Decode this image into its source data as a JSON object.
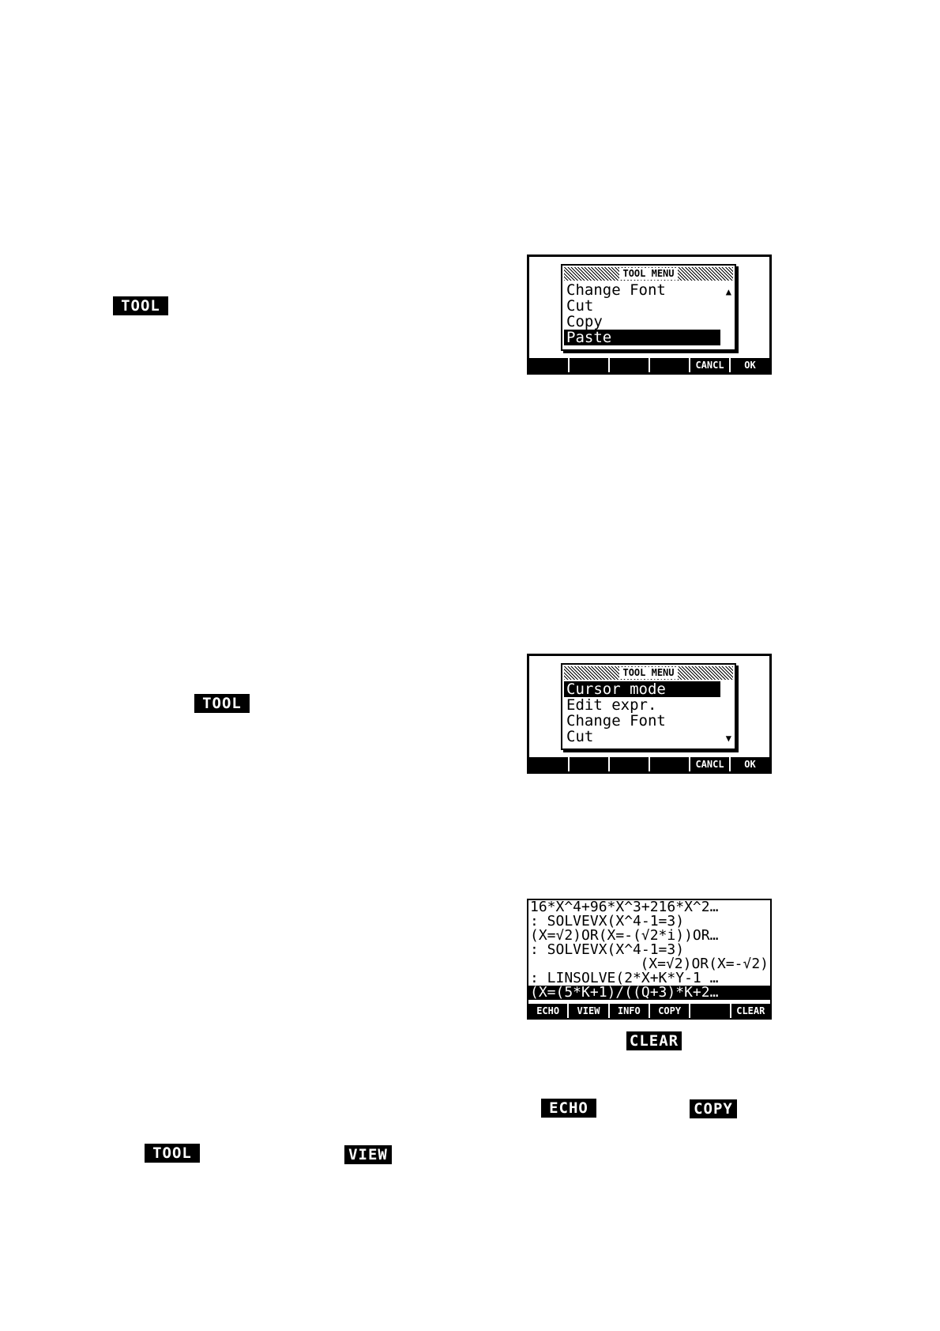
{
  "page": {
    "softkeys": {
      "tool_1": "TOOL",
      "tool_2": "TOOL",
      "clear": "CLEAR",
      "echo": "ECHO",
      "copy": "COPY",
      "tool_3": "TOOL",
      "view": "VIEW"
    }
  },
  "screen1": {
    "title": "TOOL MENU",
    "items": [
      "Change Font",
      "Cut",
      "Copy",
      "Paste"
    ],
    "selected_index": 3,
    "up_arrow": "▲",
    "menu": [
      "",
      "",
      "",
      "",
      "CANCL",
      "OK"
    ]
  },
  "screen2": {
    "title": "TOOL MENU",
    "items": [
      "Cursor mode",
      "Edit expr.",
      "Change Font",
      "Cut"
    ],
    "selected_index": 0,
    "down_arrow": "▼",
    "menu": [
      "",
      "",
      "",
      "",
      "CANCL",
      "OK"
    ]
  },
  "screen3": {
    "lines": [
      "16*X^4+96*X^3+216*X^2…",
      ": SOLVEVX(X^4-1=3)",
      "(X=√2)OR(X=-(√2*i))OR…",
      ": SOLVEVX(X^4-1=3)",
      "(X=√2)OR(X=-√2)",
      ": LINSOLVE(2*X+K*Y-1 …",
      "(X=(5*K+1)/((Q+3)*K+2…"
    ],
    "menu": [
      "ECHO",
      "VIEW",
      "INFO",
      "COPY",
      "",
      "CLEAR"
    ]
  }
}
